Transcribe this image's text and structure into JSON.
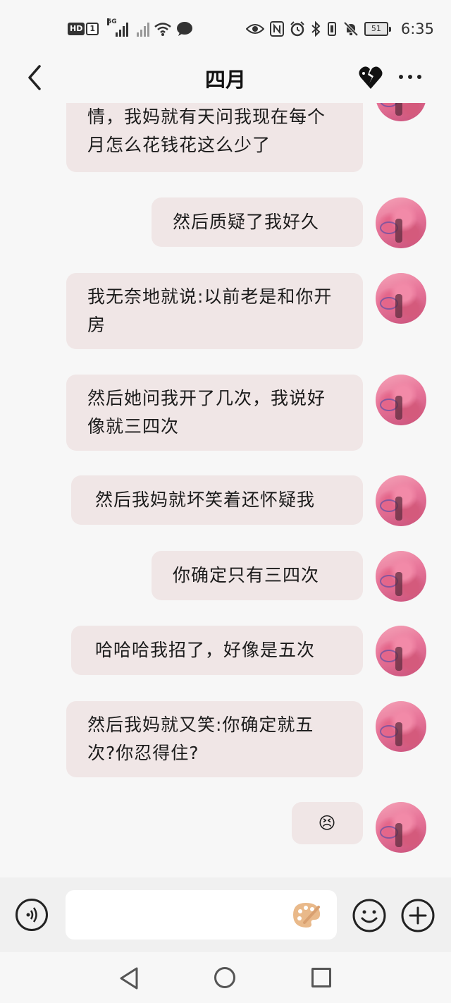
{
  "status_bar": {
    "hd_label": "HD",
    "sim_label": "1",
    "network_label": "5G",
    "battery_level": "51",
    "time": "6:35"
  },
  "header": {
    "title": "四月",
    "back_icon": "chevron-left-icon",
    "action_icon": "broken-heart-icon",
    "more_icon": "more-dots-icon"
  },
  "messages": [
    {
      "side": "right",
      "text": "情，我妈就有天问我现在每个月怎么花钱花这么少了"
    },
    {
      "side": "right",
      "text": "然后质疑了我好久"
    },
    {
      "side": "right",
      "text": "我无奈地就说:以前老是和你开房"
    },
    {
      "side": "right",
      "text": "然后她问我开了几次，我说好像就三四次"
    },
    {
      "side": "right",
      "text": "然后我妈就坏笑着还怀疑我"
    },
    {
      "side": "right",
      "text": "你确定只有三四次"
    },
    {
      "side": "right",
      "text": "哈哈哈我招了，好像是五次"
    },
    {
      "side": "right",
      "text": "然后我妈就又笑:你确定就五次?你忍得住?"
    },
    {
      "side": "right",
      "text": "😣"
    }
  ],
  "input_bar": {
    "voice_icon": "voice-icon",
    "palette_icon": "palette-icon",
    "emoji_icon": "emoji-icon",
    "plus_icon": "plus-icon",
    "placeholder": ""
  },
  "nav_bar": {
    "back_icon": "triangle-back-icon",
    "home_icon": "circle-home-icon",
    "recent_icon": "square-recent-icon"
  }
}
